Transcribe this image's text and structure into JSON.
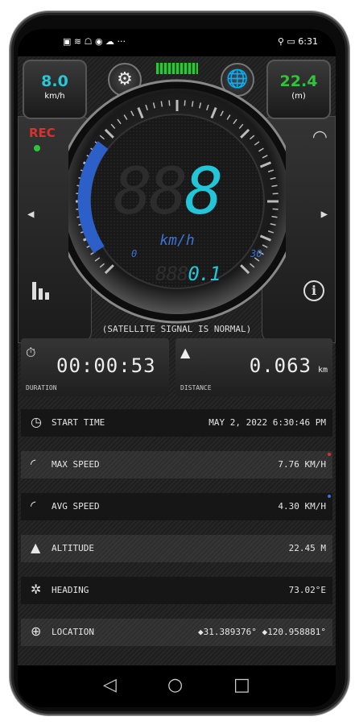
{
  "status_bar": {
    "left_icons": "▣ ≋ ☖ ◉ ☁ ···",
    "time": "6:31",
    "right_icons": "⚲ ▭"
  },
  "top_left": {
    "value": "8.0",
    "unit": "km/h",
    "value_color": "#29c7d6"
  },
  "top_right": {
    "value": "22.4",
    "unit": "(m)",
    "value_color": "#2fc43a"
  },
  "rec": {
    "label": "REC",
    "color": "#d7322f"
  },
  "gauge": {
    "ghost_digits": "88",
    "digit": "8",
    "unit": "km/h",
    "min": "0",
    "max": "30",
    "odo_ghost": "888",
    "odo_value": "0.1",
    "accent": "#23c6d8"
  },
  "status_message": "(SATELLITE SIGNAL IS NORMAL)",
  "duration": {
    "value": "00:00:53",
    "label": "DURATION",
    "icon": "stopwatch-icon"
  },
  "distance": {
    "value": "0.063",
    "unit": "km",
    "label": "DISTANCE",
    "icon": "road-icon"
  },
  "rows": [
    {
      "icon": "clock-icon",
      "label": "START TIME",
      "value": "MAY 2, 2022 6:30:46 PM"
    },
    {
      "icon": "speedometer-icon",
      "label": "MAX SPEED",
      "value": "7.76 KM/H"
    },
    {
      "icon": "speedometer-icon",
      "label": "AVG SPEED",
      "value": "4.30 KM/H"
    },
    {
      "icon": "mountain-icon",
      "label": "ALTITUDE",
      "value": "22.45 M"
    },
    {
      "icon": "compass-icon",
      "label": "HEADING",
      "value": "73.02°E"
    },
    {
      "icon": "globe-icon",
      "label": "LOCATION",
      "value": "◆31.389376° ◆120.958881°"
    }
  ]
}
